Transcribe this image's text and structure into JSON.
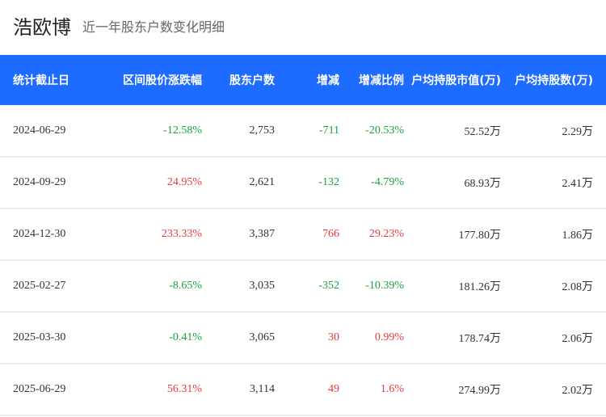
{
  "header": {
    "title": "浩欧博",
    "subtitle": "近一年股东户数变化明细"
  },
  "colors": {
    "header_bg": "#1e6bff",
    "positive": "#e83a3a",
    "negative": "#1aa33a"
  },
  "table": {
    "columns": [
      "统计截止日",
      "区间股价涨跌幅",
      "股东户数",
      "增减",
      "增减比例",
      "户均持股市值(万)",
      "户均持股数(万)"
    ],
    "rows": [
      {
        "date": "2024-06-29",
        "price_change": "-12.58%",
        "holders": "2,753",
        "change": "-711",
        "change_ratio": "-20.53%",
        "avg_value": "52.52万",
        "avg_shares": "2.29万"
      },
      {
        "date": "2024-09-29",
        "price_change": "24.95%",
        "holders": "2,621",
        "change": "-132",
        "change_ratio": "-4.79%",
        "avg_value": "68.93万",
        "avg_shares": "2.41万"
      },
      {
        "date": "2024-12-30",
        "price_change": "233.33%",
        "holders": "3,387",
        "change": "766",
        "change_ratio": "29.23%",
        "avg_value": "177.80万",
        "avg_shares": "1.86万"
      },
      {
        "date": "2025-02-27",
        "price_change": "-8.65%",
        "holders": "3,035",
        "change": "-352",
        "change_ratio": "-10.39%",
        "avg_value": "181.26万",
        "avg_shares": "2.08万"
      },
      {
        "date": "2025-03-30",
        "price_change": "-0.41%",
        "holders": "3,065",
        "change": "30",
        "change_ratio": "0.99%",
        "avg_value": "178.74万",
        "avg_shares": "2.06万"
      },
      {
        "date": "2025-06-29",
        "price_change": "56.31%",
        "holders": "3,114",
        "change": "49",
        "change_ratio": "1.6%",
        "avg_value": "274.99万",
        "avg_shares": "2.02万"
      }
    ]
  }
}
